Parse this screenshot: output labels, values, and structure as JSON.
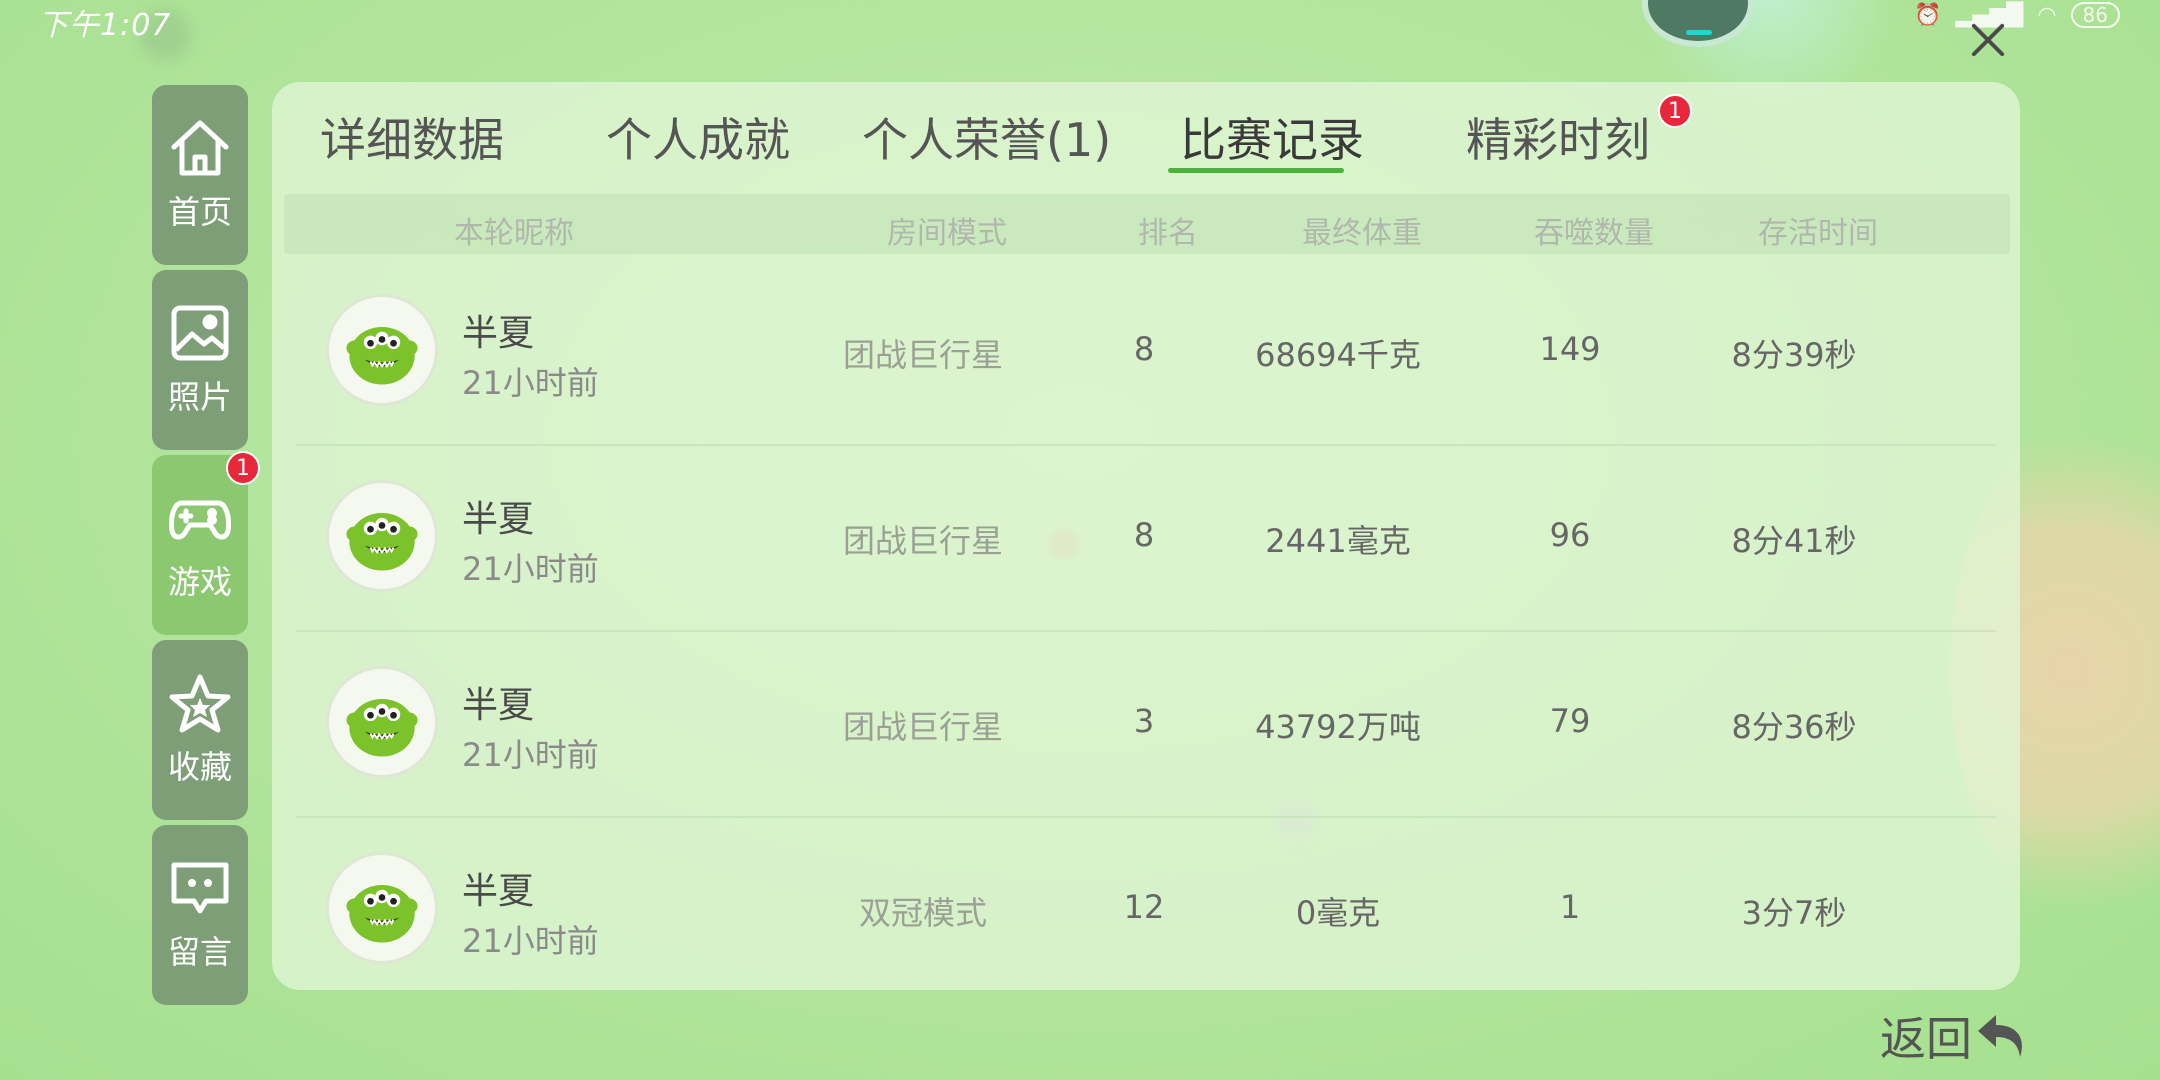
{
  "status_bar": {
    "time": "下午1:07",
    "battery": "86"
  },
  "sidebar": {
    "items": [
      {
        "label": "首页",
        "icon": "home-icon"
      },
      {
        "label": "照片",
        "icon": "photo-icon"
      },
      {
        "label": "游戏",
        "icon": "gamepad-icon",
        "badge": "1",
        "active": true
      },
      {
        "label": "收藏",
        "icon": "star-icon"
      },
      {
        "label": "留言",
        "icon": "message-icon"
      }
    ]
  },
  "tabs": [
    {
      "label": "详细数据"
    },
    {
      "label": "个人成就"
    },
    {
      "label": "个人荣誉(1)"
    },
    {
      "label": "比赛记录",
      "active": true
    },
    {
      "label": "精彩时刻",
      "badge": "1"
    }
  ],
  "table": {
    "headers": [
      "本轮昵称",
      "房间模式",
      "排名",
      "最终体重",
      "吞噬数量",
      "存活时间"
    ],
    "rows": [
      {
        "nickname": "半夏",
        "time": "21小时前",
        "mode": "团战巨行星",
        "rank": "8",
        "weight": "68694千克",
        "eaten": "149",
        "survival": "8分39秒"
      },
      {
        "nickname": "半夏",
        "time": "21小时前",
        "mode": "团战巨行星",
        "rank": "8",
        "weight": "2441毫克",
        "eaten": "96",
        "survival": "8分41秒"
      },
      {
        "nickname": "半夏",
        "time": "21小时前",
        "mode": "团战巨行星",
        "rank": "3",
        "weight": "43792万吨",
        "eaten": "79",
        "survival": "8分36秒"
      },
      {
        "nickname": "半夏",
        "time": "21小时前",
        "mode": "双冠模式",
        "rank": "12",
        "weight": "0毫克",
        "eaten": "1",
        "survival": "3分7秒"
      }
    ]
  },
  "back_button": {
    "label": "返回"
  },
  "colors": {
    "accent": "#4cb03c",
    "badge": "#e8283a",
    "sidebar": "#7e9e78",
    "sidebar_active": "#8cc870"
  }
}
